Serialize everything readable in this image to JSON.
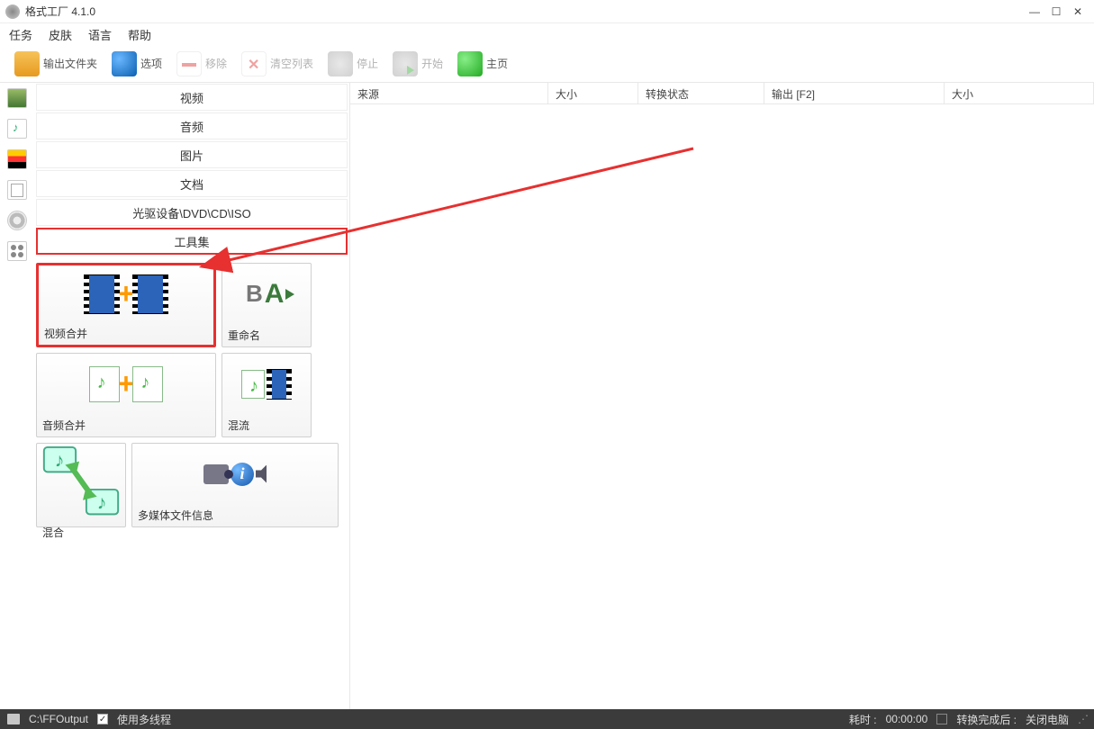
{
  "title": "格式工厂 4.1.0",
  "menus": {
    "task": "任务",
    "skin": "皮肤",
    "lang": "语言",
    "help": "帮助"
  },
  "toolbar": {
    "output_folder": "输出文件夹",
    "options": "选项",
    "remove": "移除",
    "clear": "清空列表",
    "stop": "停止",
    "start": "开始",
    "home": "主页"
  },
  "categories": {
    "video": "视频",
    "audio": "音频",
    "picture": "图片",
    "document": "文档",
    "disc": "光驱设备\\DVD\\CD\\ISO",
    "toolset": "工具集"
  },
  "tools": {
    "video_join": "视频合并",
    "rename": "重命名",
    "audio_join": "音频合并",
    "mux": "混流",
    "mix": "混合",
    "media_info": "多媒体文件信息"
  },
  "columns": {
    "source": "来源",
    "size": "大小",
    "status": "转换状态",
    "output": "输出 [F2]",
    "size2": "大小"
  },
  "status": {
    "path": "C:\\FFOutput",
    "multithread": "使用多线程",
    "elapsed_label": "耗时 :",
    "elapsed": "00:00:00",
    "after_label": "转换完成后 :",
    "after_value": "关闭电脑"
  }
}
